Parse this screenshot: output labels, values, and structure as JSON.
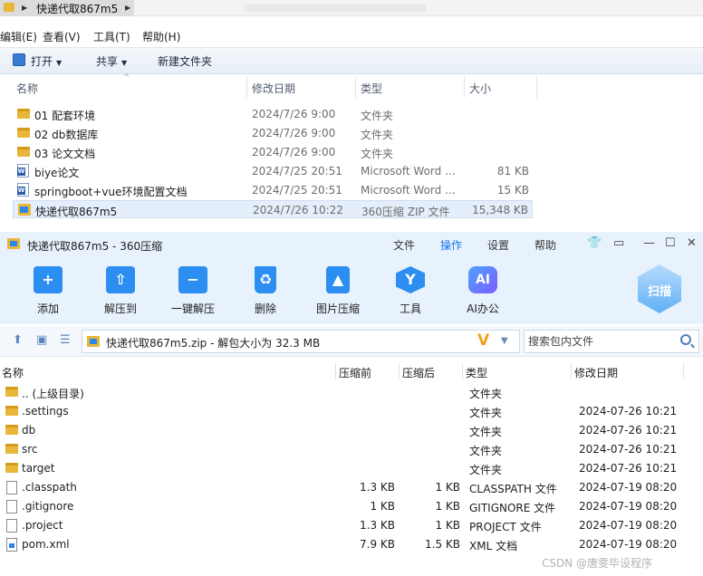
{
  "explorer": {
    "breadcrumb": "快递代取867m5",
    "menu": [
      "编辑(E)",
      "查看(V)",
      "工具(T)",
      "帮助(H)"
    ],
    "toolbar": {
      "open": "打开",
      "share": "共享",
      "new_folder": "新建文件夹"
    },
    "columns": {
      "name": "名称",
      "modified": "修改日期",
      "type": "类型",
      "size": "大小"
    },
    "rows": [
      {
        "name": "01 配套环境",
        "date": "2024/7/26 9:00",
        "type": "文件夹",
        "size": "",
        "icon": "folder-icon"
      },
      {
        "name": "02 db数据库",
        "date": "2024/7/26 9:00",
        "type": "文件夹",
        "size": "",
        "icon": "folder-icon"
      },
      {
        "name": "03 论文文档",
        "date": "2024/7/26 9:00",
        "type": "文件夹",
        "size": "",
        "icon": "folder-icon"
      },
      {
        "name": "biye论文",
        "date": "2024/7/25 20:51",
        "type": "Microsoft Word ...",
        "size": "81 KB",
        "icon": "word-doc-icon"
      },
      {
        "name": "springboot+vue环境配置文档",
        "date": "2024/7/25 20:51",
        "type": "Microsoft Word ...",
        "size": "15 KB",
        "icon": "word-doc-icon"
      },
      {
        "name": "快递代取867m5",
        "date": "2024/7/26 10:22",
        "type": "360压缩 ZIP 文件",
        "size": "15,348 KB",
        "icon": "zip-icon",
        "selected": true
      }
    ]
  },
  "zip": {
    "title": "快递代取867m5 - 360压缩",
    "tabs": [
      "文件",
      "操作",
      "设置",
      "帮助"
    ],
    "active_tab": "操作",
    "ribbon": [
      "添加",
      "解压到",
      "一键解压",
      "删除",
      "图片压缩",
      "工具",
      "AI办公"
    ],
    "scan_label": "扫描",
    "ai_badge": "AI",
    "path": "快递代取867m5.zip - 解包大小为 32.3 MB",
    "search_placeholder": "搜索包内文件",
    "columns": {
      "name": "名称",
      "packed": "压缩前",
      "unpacked": "压缩后",
      "type": "类型",
      "modified": "修改日期"
    },
    "rows": [
      {
        "name": ".. (上级目录)",
        "packed": "",
        "unpacked": "",
        "type": "文件夹",
        "date": "",
        "icon": "folder-icon"
      },
      {
        "name": ".settings",
        "packed": "",
        "unpacked": "",
        "type": "文件夹",
        "date": "2024-07-26 10:21",
        "icon": "folder-icon"
      },
      {
        "name": "db",
        "packed": "",
        "unpacked": "",
        "type": "文件夹",
        "date": "2024-07-26 10:21",
        "icon": "folder-icon"
      },
      {
        "name": "src",
        "packed": "",
        "unpacked": "",
        "type": "文件夹",
        "date": "2024-07-26 10:21",
        "icon": "folder-icon"
      },
      {
        "name": "target",
        "packed": "",
        "unpacked": "",
        "type": "文件夹",
        "date": "2024-07-26 10:21",
        "icon": "folder-icon"
      },
      {
        "name": ".classpath",
        "packed": "1.3 KB",
        "unpacked": "1 KB",
        "type": "CLASSPATH 文件",
        "date": "2024-07-19 08:20",
        "icon": "file-icon"
      },
      {
        "name": ".gitignore",
        "packed": "1 KB",
        "unpacked": "1 KB",
        "type": "GITIGNORE 文件",
        "date": "2024-07-19 08:20",
        "icon": "file-icon"
      },
      {
        "name": ".project",
        "packed": "1.3 KB",
        "unpacked": "1 KB",
        "type": "PROJECT 文件",
        "date": "2024-07-19 08:20",
        "icon": "file-icon"
      },
      {
        "name": "pom.xml",
        "packed": "7.9 KB",
        "unpacked": "1.5 KB",
        "type": "XML 文档",
        "date": "2024-07-19 08:20",
        "icon": "xml-file-icon"
      }
    ]
  },
  "watermark": "CSDN @唐雯毕设程序"
}
